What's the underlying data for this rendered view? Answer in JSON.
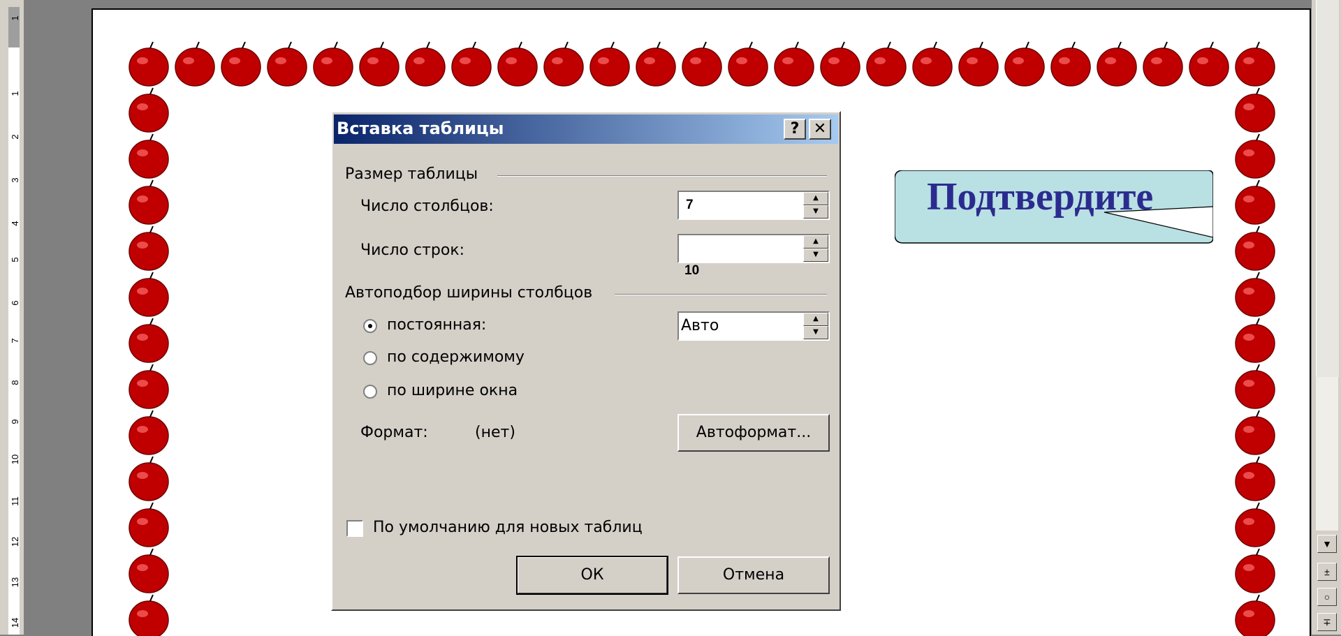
{
  "ruler": {
    "ticks": [
      "1",
      "1",
      "2",
      "3",
      "4",
      "5",
      "6",
      "7",
      "8",
      "9",
      "10",
      "11",
      "12",
      "13",
      "14"
    ]
  },
  "dialog": {
    "title": "Вставка таблицы",
    "help_button": "?",
    "close_button": "✕",
    "size_group": {
      "label": "Размер таблицы",
      "columns_label": "Число столбцов:",
      "columns_value": "7",
      "rows_label": "Число строк:",
      "rows_value": "",
      "rows_overflow_value": "10"
    },
    "autofit_group": {
      "label": "Автоподбор ширины столбцов",
      "options": [
        {
          "label": "постоянная:",
          "selected": true
        },
        {
          "label": "по содержимому",
          "selected": false
        },
        {
          "label": "по ширине окна",
          "selected": false
        }
      ],
      "fixed_width_value": "Авто"
    },
    "format_label": "Формат:",
    "format_value": "(нет)",
    "autoformat_button": "Автоформат...",
    "default_checkbox": {
      "label": "По умолчанию для новых таблиц",
      "checked": false
    },
    "ok_button": "ОК",
    "cancel_button": "Отмена"
  },
  "callout": {
    "text": "Подтвердите",
    "fill_color": "#b9e0e3",
    "text_color": "#2b2b8f"
  },
  "page_border": {
    "motif": "red-apple",
    "color": "#c00000"
  },
  "scrollbar": {
    "down_arrow": "▼",
    "prev_page": "±",
    "select_browse": "○",
    "next_page": "∓"
  },
  "colors": {
    "titlebar_start": "#0a246a",
    "titlebar_end": "#a6caf0",
    "dialog_face": "#d4d0c8",
    "desk": "#808080"
  }
}
